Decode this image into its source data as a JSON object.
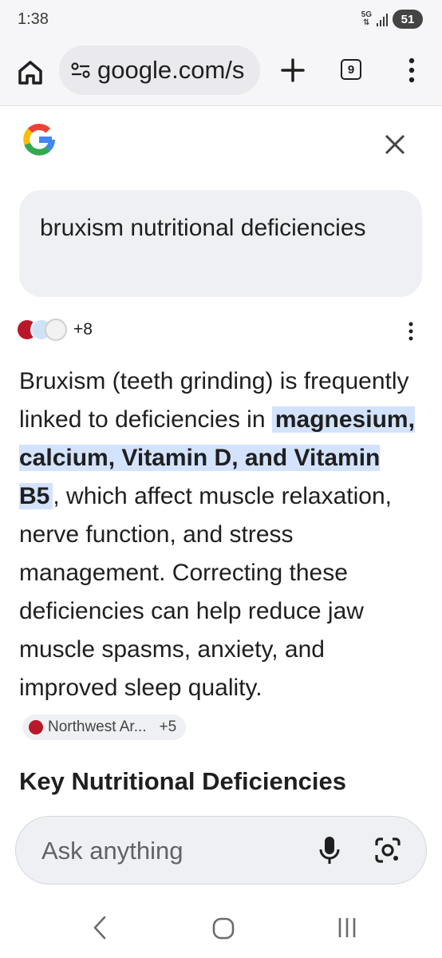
{
  "status_bar": {
    "time": "1:38",
    "network": "5G",
    "battery": "51"
  },
  "browser": {
    "url": "google.com/s",
    "tab_count": "9"
  },
  "page": {
    "query": "bruxism nutritional deficiencies",
    "sources_more": "+8",
    "answer": {
      "part1": "Bruxism (teeth grinding) is frequently linked to deficiencies in ",
      "highlight": "magnesium, calcium, Vitamin D, and Vitamin B5",
      "part2": ", which affect muscle relaxation, nerve function, and stress management. Correcting these deficiencies can help reduce jaw muscle spasms, anxiety, and improved sleep quality.",
      "citation_source": "Northwest Ar...",
      "citation_more": "+5"
    },
    "section_heading": "Key Nutritional Deficiencies"
  },
  "ask_bar": {
    "placeholder": "Ask anything"
  },
  "icons": {
    "home": "home-icon",
    "site_settings": "tune-icon",
    "new_tab": "plus-icon",
    "menu": "more-vert-icon",
    "close": "close-icon",
    "mic": "mic-icon",
    "lens": "google-lens-icon"
  },
  "colors": {
    "highlight": "#d3e3fd",
    "google_blue": "#4285f4",
    "google_red": "#ea4335",
    "google_yellow": "#fbbc05",
    "google_green": "#34a853"
  }
}
